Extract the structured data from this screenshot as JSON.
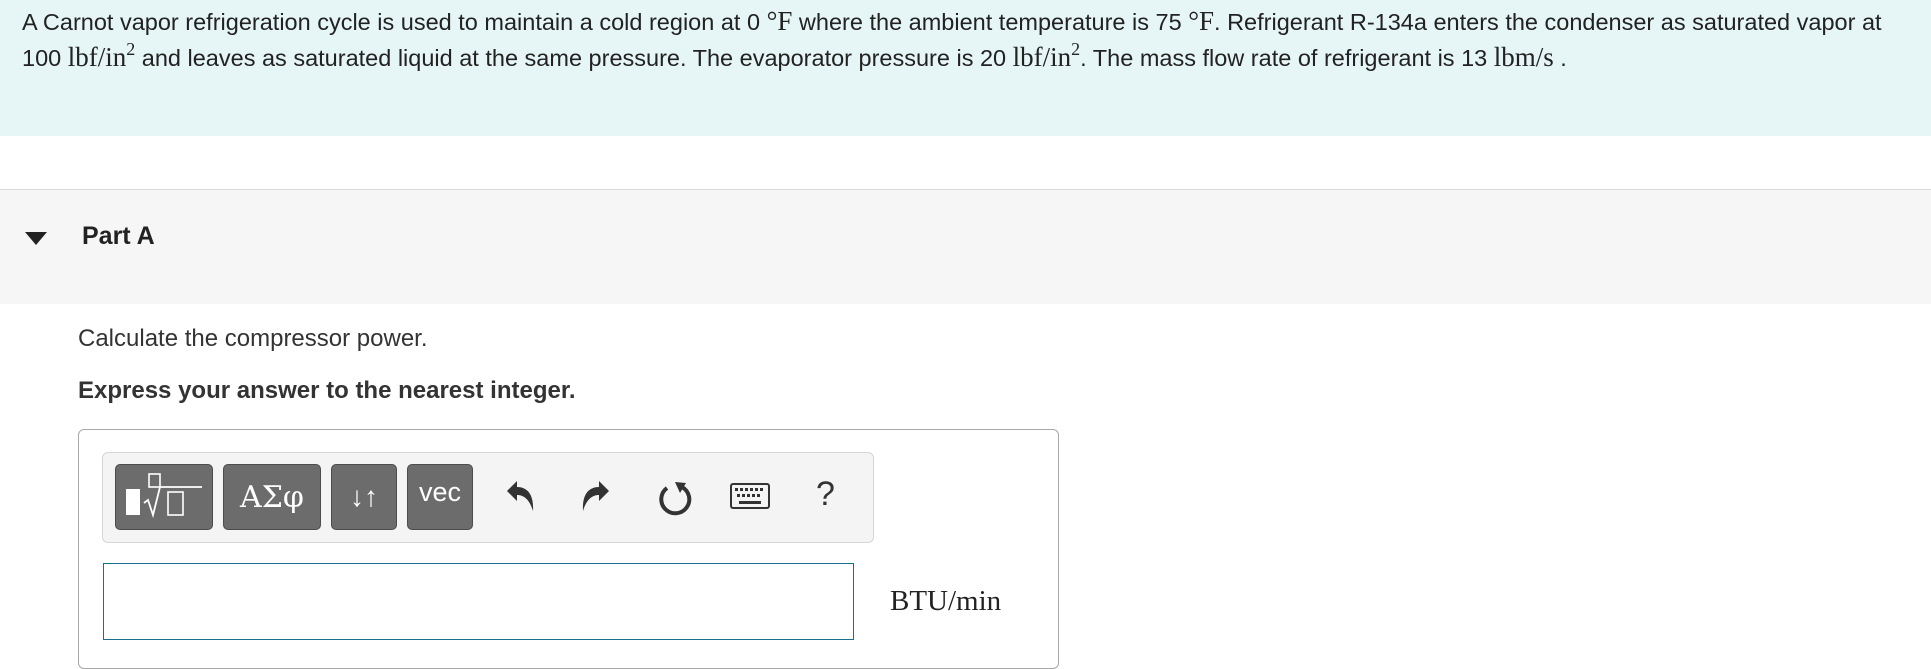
{
  "problem": {
    "seg1": "A Carnot vapor refrigeration cycle is used to maintain a cold region at 0 ",
    "deg1": "°F",
    "seg2": " where the ambient temperature is 75 ",
    "deg2": "°F",
    "seg3": ". Refrigerant R-134a enters the condenser as saturated vapor at 100 ",
    "unit1": "lbf/in",
    "sup1": "2",
    "seg4": " and leaves as saturated liquid at the same pressure. The evaporator pressure is 20 ",
    "unit2": "lbf/in",
    "sup2": "2",
    "seg5": ". The mass flow rate of refrigerant is 13 ",
    "unit3": "lbm/s",
    "seg6": " ."
  },
  "part": {
    "title": "Part A",
    "caret": "collapse-caret"
  },
  "question": "Calculate the compressor power.",
  "instruction": "Express your answer to the nearest integer.",
  "toolbar": {
    "greek_label": "ΑΣφ",
    "arrows_label": "↓↑",
    "vec_label": "vec",
    "help_label": "?",
    "icons": [
      "templates-icon",
      "undo-icon",
      "redo-icon",
      "reset-icon",
      "keyboard-icon",
      "help-icon"
    ]
  },
  "answer": {
    "value": "",
    "placeholder": "",
    "units": "BTU/min"
  },
  "colors": {
    "problem_bg": "#e6f6f6",
    "button_bg": "#6c6c6c",
    "input_border": "#1a6f8f"
  }
}
